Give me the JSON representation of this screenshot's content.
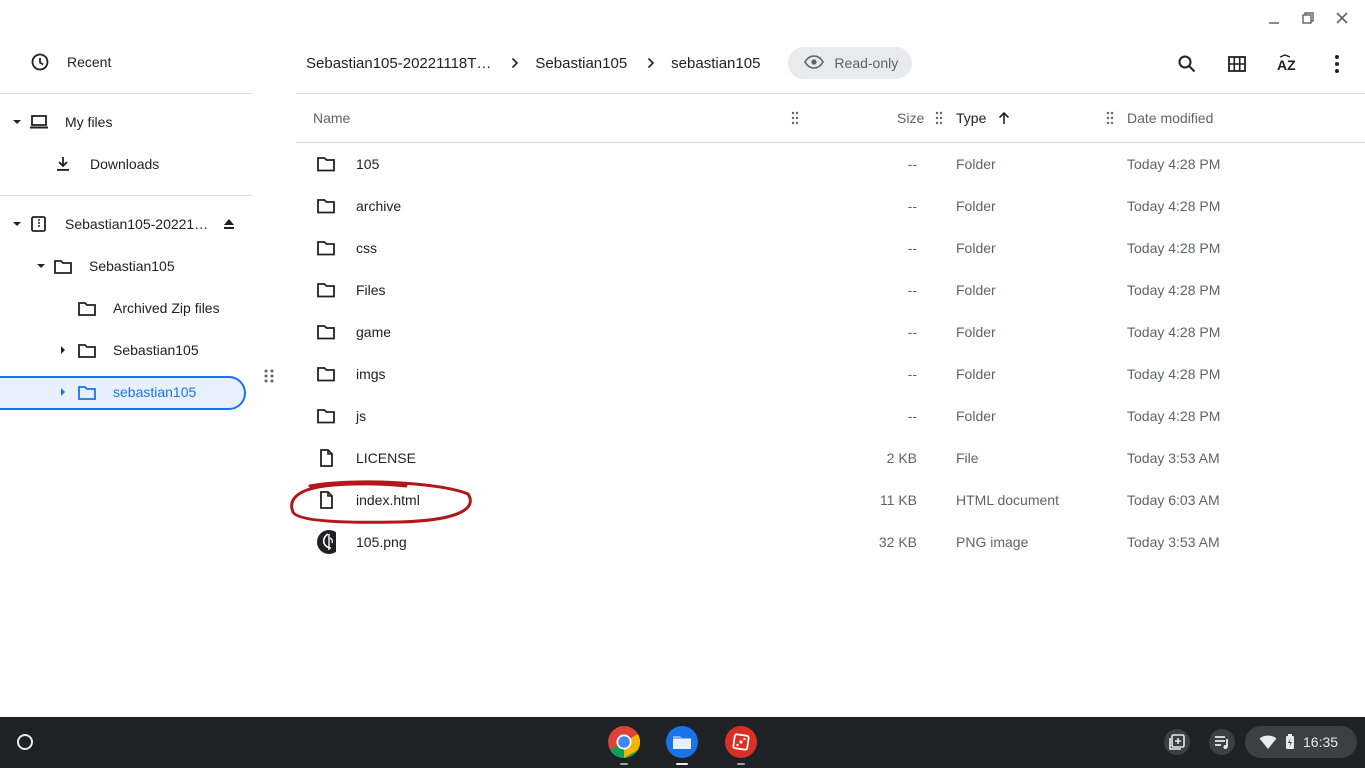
{
  "window": {
    "minimize_icon": "minimize-icon",
    "restore_icon": "restore-icon",
    "close_icon": "close-icon"
  },
  "sidebar": {
    "recent": "Recent",
    "my_files": "My files",
    "downloads": "Downloads",
    "archive_root": "Sebastian105-20221…",
    "folder_sebastian": "Sebastian105",
    "archived_zip": "Archived Zip files",
    "sub_sebastian": "Sebastian105",
    "selected": "sebastian105"
  },
  "breadcrumb": {
    "items": [
      "Sebastian105-20221118T…",
      "Sebastian105",
      "sebastian105"
    ],
    "chip": "Read-only"
  },
  "columns": {
    "name": "Name",
    "size": "Size",
    "type": "Type",
    "date": "Date modified"
  },
  "files": [
    {
      "name": "105",
      "size": "--",
      "type": "Folder",
      "date": "Today 4:28 PM",
      "icon": "folder-icon"
    },
    {
      "name": "archive",
      "size": "--",
      "type": "Folder",
      "date": "Today 4:28 PM",
      "icon": "folder-icon"
    },
    {
      "name": "css",
      "size": "--",
      "type": "Folder",
      "date": "Today 4:28 PM",
      "icon": "folder-icon"
    },
    {
      "name": "Files",
      "size": "--",
      "type": "Folder",
      "date": "Today 4:28 PM",
      "icon": "folder-icon"
    },
    {
      "name": "game",
      "size": "--",
      "type": "Folder",
      "date": "Today 4:28 PM",
      "icon": "folder-icon"
    },
    {
      "name": "imgs",
      "size": "--",
      "type": "Folder",
      "date": "Today 4:28 PM",
      "icon": "folder-icon"
    },
    {
      "name": "js",
      "size": "--",
      "type": "Folder",
      "date": "Today 4:28 PM",
      "icon": "folder-icon"
    },
    {
      "name": "LICENSE",
      "size": "2 KB",
      "type": "File",
      "date": "Today 3:53 AM",
      "icon": "file-icon"
    },
    {
      "name": "index.html",
      "size": "11 KB",
      "type": "HTML document",
      "date": "Today 6:03 AM",
      "icon": "file-icon"
    },
    {
      "name": "105.png",
      "size": "32 KB",
      "type": "PNG image",
      "date": "Today 3:53 AM",
      "icon": "image-thumbnail-icon"
    }
  ],
  "shelf": {
    "time": "16:35"
  },
  "colors": {
    "accent": "#1a73e8",
    "annotation": "#b3161b",
    "shelf": "#202124"
  }
}
